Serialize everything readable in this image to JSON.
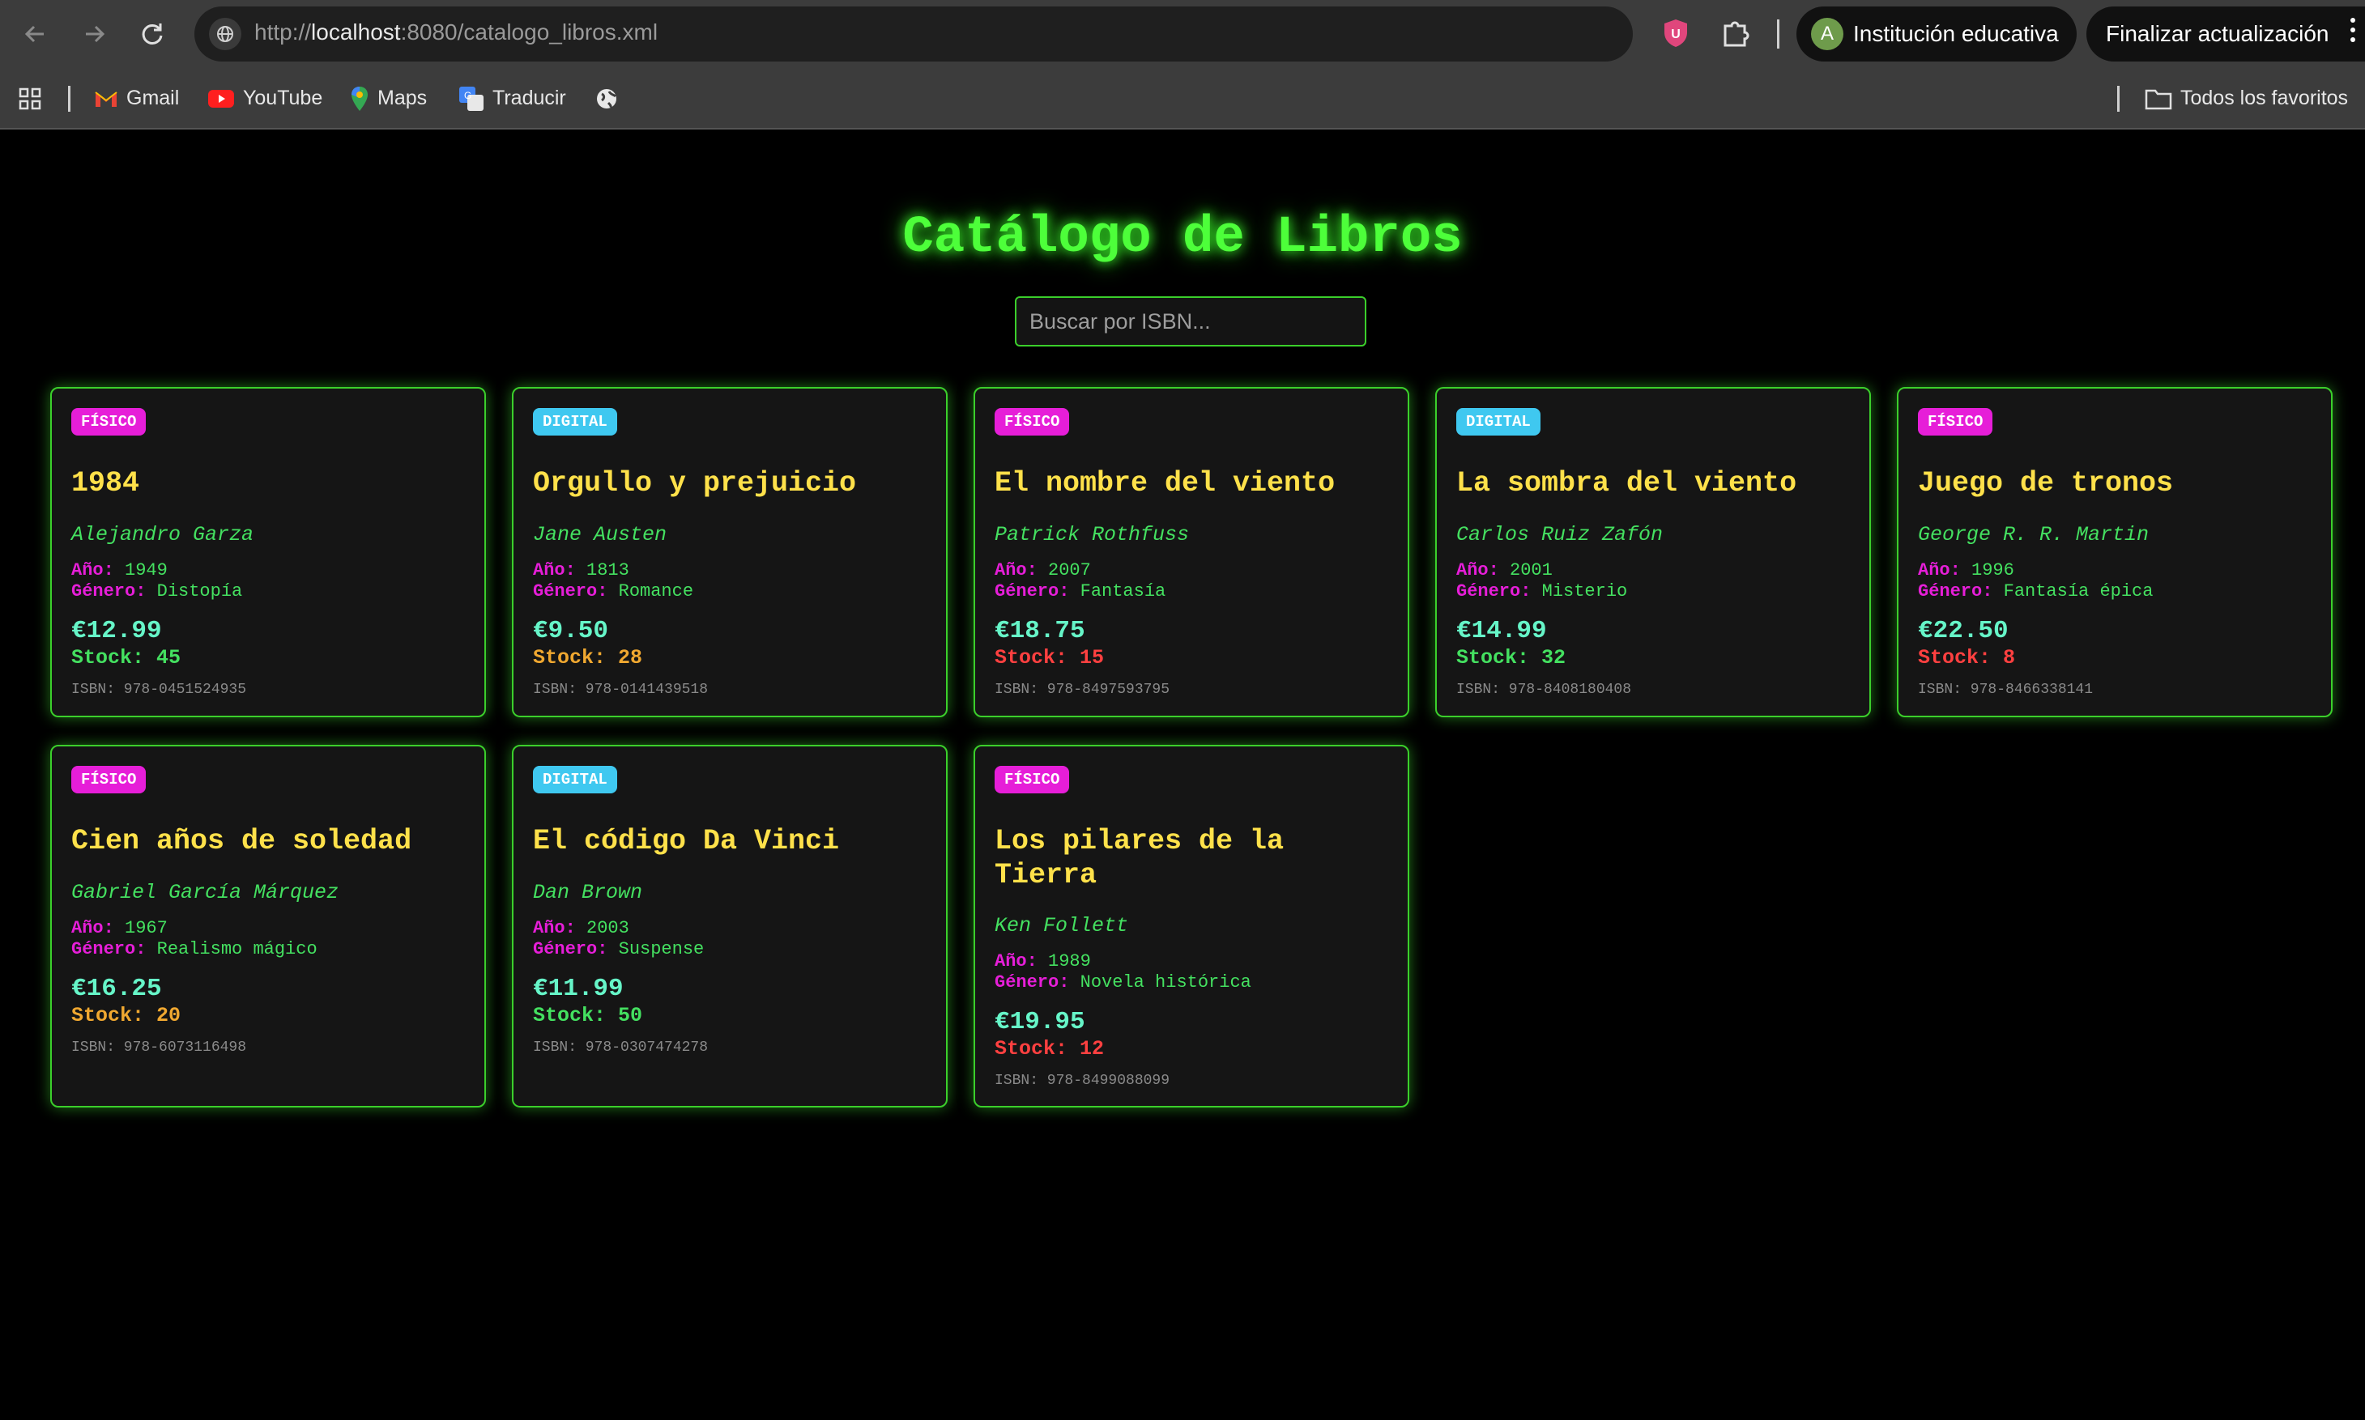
{
  "browser": {
    "url_prefix": "http://",
    "url_host": "localhost",
    "url_rest": ":8080/catalogo_libros.xml",
    "profile_initial": "A",
    "profile_name": "Institución educativa",
    "update_label": "Finalizar actualización",
    "bookmarks": {
      "gmail": "Gmail",
      "youtube": "YouTube",
      "maps": "Maps",
      "translate": "Traducir",
      "all_favorites": "Todos los favoritos"
    }
  },
  "page": {
    "title": "Catálogo de Libros",
    "search_placeholder": "Buscar por ISBN...",
    "labels": {
      "year": "Año:",
      "genre": "Género:"
    }
  },
  "books": [
    {
      "format": "FÍSICO",
      "title": "1984",
      "author": "Alejandro Garza",
      "year": "1949",
      "genre": "Distopía",
      "price": "€12.99",
      "stock": "Stock: 45",
      "isbn": "ISBN: 978-0451524935"
    },
    {
      "format": "DIGITAL",
      "title": "Orgullo y prejuicio",
      "author": "Jane Austen",
      "year": "1813",
      "genre": "Romance",
      "price": "€9.50",
      "stock": "Stock: 28",
      "isbn": "ISBN: 978-0141439518"
    },
    {
      "format": "FÍSICO",
      "title": "El nombre del viento",
      "author": "Patrick Rothfuss",
      "year": "2007",
      "genre": "Fantasía",
      "price": "€18.75",
      "stock": "Stock: 15",
      "isbn": "ISBN: 978-8497593795"
    },
    {
      "format": "DIGITAL",
      "title": "La sombra del viento",
      "author": "Carlos Ruiz Zafón",
      "year": "2001",
      "genre": "Misterio",
      "price": "€14.99",
      "stock": "Stock: 32",
      "isbn": "ISBN: 978-8408180408"
    },
    {
      "format": "FÍSICO",
      "title": "Juego de tronos",
      "author": "George R. R. Martin",
      "year": "1996",
      "genre": "Fantasía épica",
      "price": "€22.50",
      "stock": "Stock: 8",
      "isbn": "ISBN: 978-8466338141"
    },
    {
      "format": "FÍSICO",
      "title": "Cien años de soledad",
      "author": "Gabriel García Márquez",
      "year": "1967",
      "genre": "Realismo mágico",
      "price": "€16.25",
      "stock": "Stock: 20",
      "isbn": "ISBN: 978-6073116498"
    },
    {
      "format": "DIGITAL",
      "title": "El código Da Vinci",
      "author": "Dan Brown",
      "year": "2003",
      "genre": "Suspense",
      "price": "€11.99",
      "stock": "Stock: 50",
      "isbn": "ISBN: 978-0307474278"
    },
    {
      "format": "FÍSICO",
      "title": "Los pilares de la Tierra",
      "author": "Ken Follett",
      "year": "1989",
      "genre": "Novela histórica",
      "price": "€19.95",
      "stock": "Stock: 12",
      "isbn": "ISBN: 978-8499088099"
    }
  ],
  "colors": {
    "stock_high": "#44e060",
    "stock_mid": "#f0a830",
    "stock_low": "#ff4040"
  }
}
